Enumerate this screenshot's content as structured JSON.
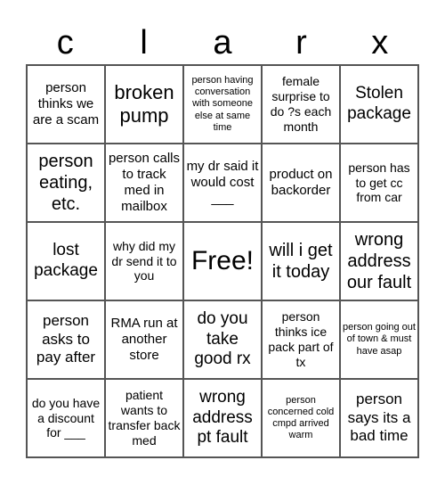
{
  "header": {
    "letters": [
      "c",
      "l",
      "a",
      "r",
      "x"
    ]
  },
  "cells": [
    "person thinks we are a scam",
    "broken pump",
    "person having conversation with someone else at same time",
    "female surprise to do ?s each month",
    "Stolen package",
    "person eating, etc.",
    "person calls to track med in mailbox",
    "my dr said it would cost ___",
    "product on backorder",
    "person has to get cc from car",
    "lost package",
    "why did my dr send it to you",
    "Free!",
    "will i get it today",
    "wrong address our fault",
    "person asks to pay after",
    "RMA run at another store",
    "do you take good rx",
    "person thinks ice pack part of tx",
    "person going out of town & must have asap",
    "do you have a discount for ___",
    "patient wants to transfer back med",
    "wrong address pt fault",
    "person concerned cold cmpd arrived warm",
    "person says its a bad time"
  ]
}
